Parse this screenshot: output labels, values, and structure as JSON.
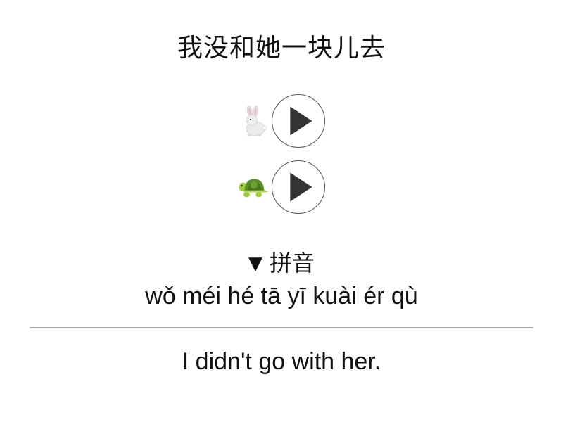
{
  "sentence": {
    "hanzi": "我没和她一块儿去"
  },
  "audio": {
    "fast": {
      "icon": "rabbit-icon"
    },
    "slow": {
      "icon": "turtle-icon"
    },
    "play_icon": "play-icon"
  },
  "pinyin": {
    "toggle_arrow": "▼",
    "toggle_label": "拼音",
    "text": "wǒ méi hé tā yī kuài ér qù"
  },
  "translation": {
    "text": "I didn't go with her."
  },
  "colors": {
    "text": "#111111",
    "play_border": "#555555",
    "play_triangle": "#333333",
    "divider": "#aaaaaa",
    "turtle_shell": "#5d8f2a",
    "turtle_body": "#9ccc3a"
  }
}
